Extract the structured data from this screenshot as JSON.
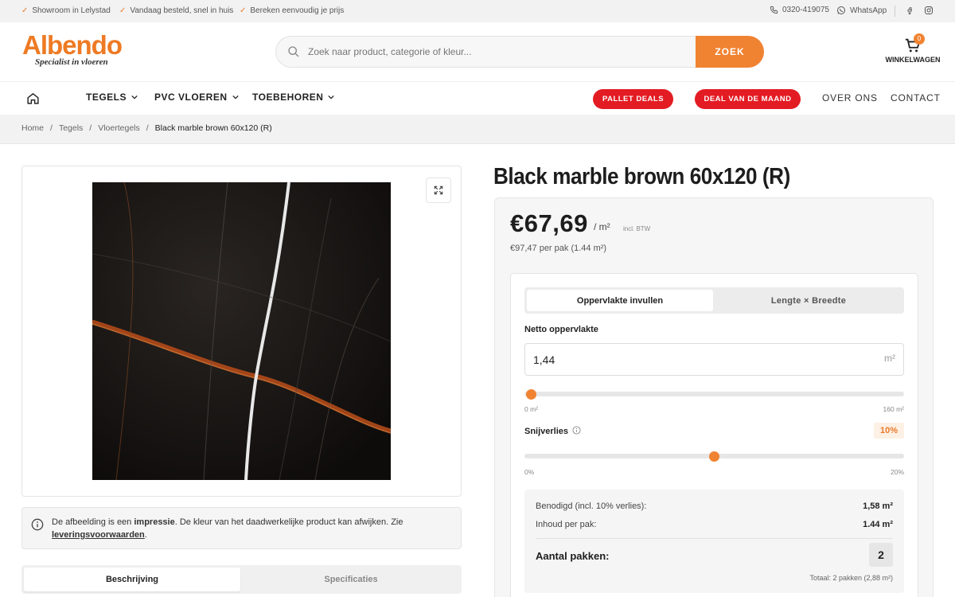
{
  "topbar": {
    "usps": [
      "Showroom in Lelystad",
      "Vandaag besteld, snel in huis",
      "Bereken eenvoudig je prijs"
    ],
    "phone": "0320-419075",
    "whatsapp": "WhatsApp",
    "icons": [
      "check-icon",
      "phone-icon",
      "whatsapp-icon",
      "facebook-icon",
      "instagram-icon"
    ]
  },
  "header": {
    "logo_name": "Albendo",
    "logo_tagline": "Specialist in vloeren",
    "search_placeholder": "Zoek naar product, categorie of kleur...",
    "search_button": "ZOEK",
    "cart_count": "0",
    "cart_label": "WINKELWAGEN",
    "accent_color": "#f08332"
  },
  "nav": {
    "items": [
      "TEGELS",
      "PVC VLOEREN",
      "TOEBEHOREN"
    ],
    "deals": [
      "PALLET DEALS",
      "DEAL VAN DE MAAND"
    ],
    "links": [
      "OVER ONS",
      "CONTACT"
    ],
    "deal_color": "#e31b23"
  },
  "breadcrumb": {
    "items": [
      "Home",
      "Tegels",
      "Vloertegels"
    ],
    "current": "Black marble brown 60x120 (R)",
    "separator": "/"
  },
  "product": {
    "title": "Black marble brown 60x120 (R)",
    "notice_pre": "De afbeelding is een ",
    "notice_bold": "impressie",
    "notice_mid": ". De kleur van het daadwerkelijke product kan afwijken. Zie ",
    "notice_link": "leveringsvoorwaarden",
    "notice_end": ".",
    "tabs": [
      "Beschrijving",
      "Specificaties"
    ]
  },
  "pricing": {
    "price": "€67,69",
    "unit": "/ m²",
    "vat": "incl. BTW",
    "per_pack": "€97,47 per pak (1.44 m²)"
  },
  "calculator": {
    "modes": [
      "Oppervlakte invullen",
      "Lengte × Breedte"
    ],
    "area_label": "Netto oppervlakte",
    "area_value": "1,44",
    "area_unit": "m²",
    "area_min": "0 m²",
    "area_max": "160 m²",
    "area_slider_value": 1.44,
    "area_slider_max": 160,
    "waste_label": "Snijverlies",
    "waste_value": "10%",
    "waste_min": "0%",
    "waste_max": "20%",
    "waste_slider_value": 10,
    "waste_slider_max": 20,
    "needed_label": "Benodigd (incl. 10% verlies):",
    "needed_value": "1,58 m²",
    "content_label": "Inhoud per pak:",
    "content_value": "1.44 m²",
    "packs_label": "Aantal pakken:",
    "packs_value": "2",
    "total": "Totaal: 2 pakken (2,88 m²)"
  }
}
